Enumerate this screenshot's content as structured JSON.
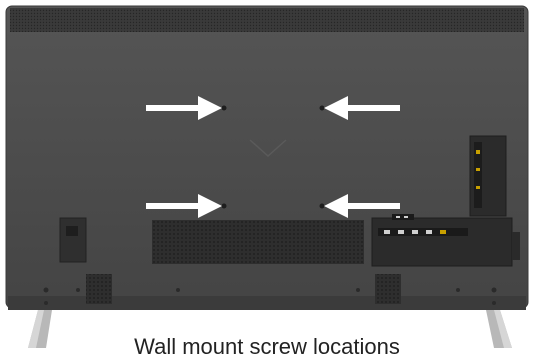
{
  "figure": {
    "subject": "tv-back-panel",
    "caption": "Wall mount screw locations",
    "colors": {
      "background": "#ffffff",
      "panel": "#4a4a4a",
      "panel_dark": "#2f2f2f",
      "arrow": "#ffffff",
      "stand": "#b8b8b8"
    },
    "mount_points": [
      {
        "label": "top-left"
      },
      {
        "label": "top-right"
      },
      {
        "label": "bottom-left"
      },
      {
        "label": "bottom-right"
      }
    ]
  }
}
